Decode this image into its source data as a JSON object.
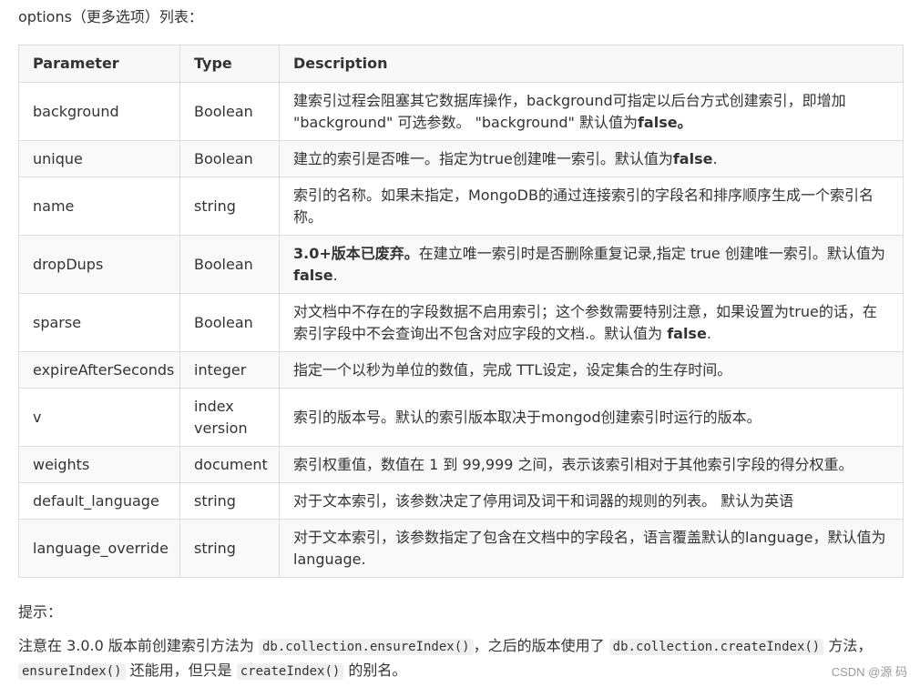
{
  "intro": "options（更多选项）列表：",
  "table": {
    "headers": [
      "Parameter",
      "Type",
      "Description"
    ],
    "rows": [
      {
        "param": "background",
        "type": "Boolean",
        "desc": [
          {
            "text": "建索引过程会阻塞其它数据库操作，background可指定以后台方式创建索引，即增加 \"background\" 可选参数。 \"background\" 默认值为",
            "bold": false
          },
          {
            "text": "false。",
            "bold": true
          }
        ]
      },
      {
        "param": "unique",
        "type": "Boolean",
        "desc": [
          {
            "text": "建立的索引是否唯一。指定为true创建唯一索引。默认值为",
            "bold": false
          },
          {
            "text": "false",
            "bold": true
          },
          {
            "text": ".",
            "bold": false
          }
        ]
      },
      {
        "param": "name",
        "type": "string",
        "desc": [
          {
            "text": "索引的名称。如果未指定，MongoDB的通过连接索引的字段名和排序顺序生成一个索引名称。",
            "bold": false
          }
        ]
      },
      {
        "param": "dropDups",
        "type": "Boolean",
        "desc": [
          {
            "text": "3.0+版本已废弃。",
            "bold": true
          },
          {
            "text": "在建立唯一索引时是否删除重复记录,指定 true 创建唯一索引。默认值为 ",
            "bold": false
          },
          {
            "text": "false",
            "bold": true
          },
          {
            "text": ".",
            "bold": false
          }
        ]
      },
      {
        "param": "sparse",
        "type": "Boolean",
        "desc": [
          {
            "text": "对文档中不存在的字段数据不启用索引；这个参数需要特别注意，如果设置为true的话，在索引字段中不会查询出不包含对应字段的文档.。默认值为 ",
            "bold": false
          },
          {
            "text": "false",
            "bold": true
          },
          {
            "text": ".",
            "bold": false
          }
        ]
      },
      {
        "param": "expireAfterSeconds",
        "type": "integer",
        "desc": [
          {
            "text": "指定一个以秒为单位的数值，完成 TTL设定，设定集合的生存时间。",
            "bold": false
          }
        ]
      },
      {
        "param": "v",
        "type": "index version",
        "desc": [
          {
            "text": "索引的版本号。默认的索引版本取决于mongod创建索引时运行的版本。",
            "bold": false
          }
        ]
      },
      {
        "param": "weights",
        "type": "document",
        "desc": [
          {
            "text": "索引权重值，数值在 1 到 99,999 之间，表示该索引相对于其他索引字段的得分权重。",
            "bold": false
          }
        ]
      },
      {
        "param": "default_language",
        "type": "string",
        "desc": [
          {
            "text": "对于文本索引，该参数决定了停用词及词干和词器的规则的列表。 默认为英语",
            "bold": false
          }
        ]
      },
      {
        "param": "language_override",
        "type": "string",
        "desc": [
          {
            "text": "对于文本索引，该参数指定了包含在文档中的字段名，语言覆盖默认的language，默认值为 language.",
            "bold": false
          }
        ]
      }
    ]
  },
  "hint": "提示：",
  "note": {
    "part1": "注意在 3.0.0 版本前创建索引方法为 ",
    "code1": "db.collection.ensureIndex()",
    "part2": "，之后的版本使用了 ",
    "code2": "db.collection.createIndex()",
    "part3": " 方法，",
    "code3": "ensureIndex()",
    "part4": " 还能用，但只是 ",
    "code4": "createIndex()",
    "part5": " 的别名。"
  },
  "watermark": "CSDN @源 码"
}
